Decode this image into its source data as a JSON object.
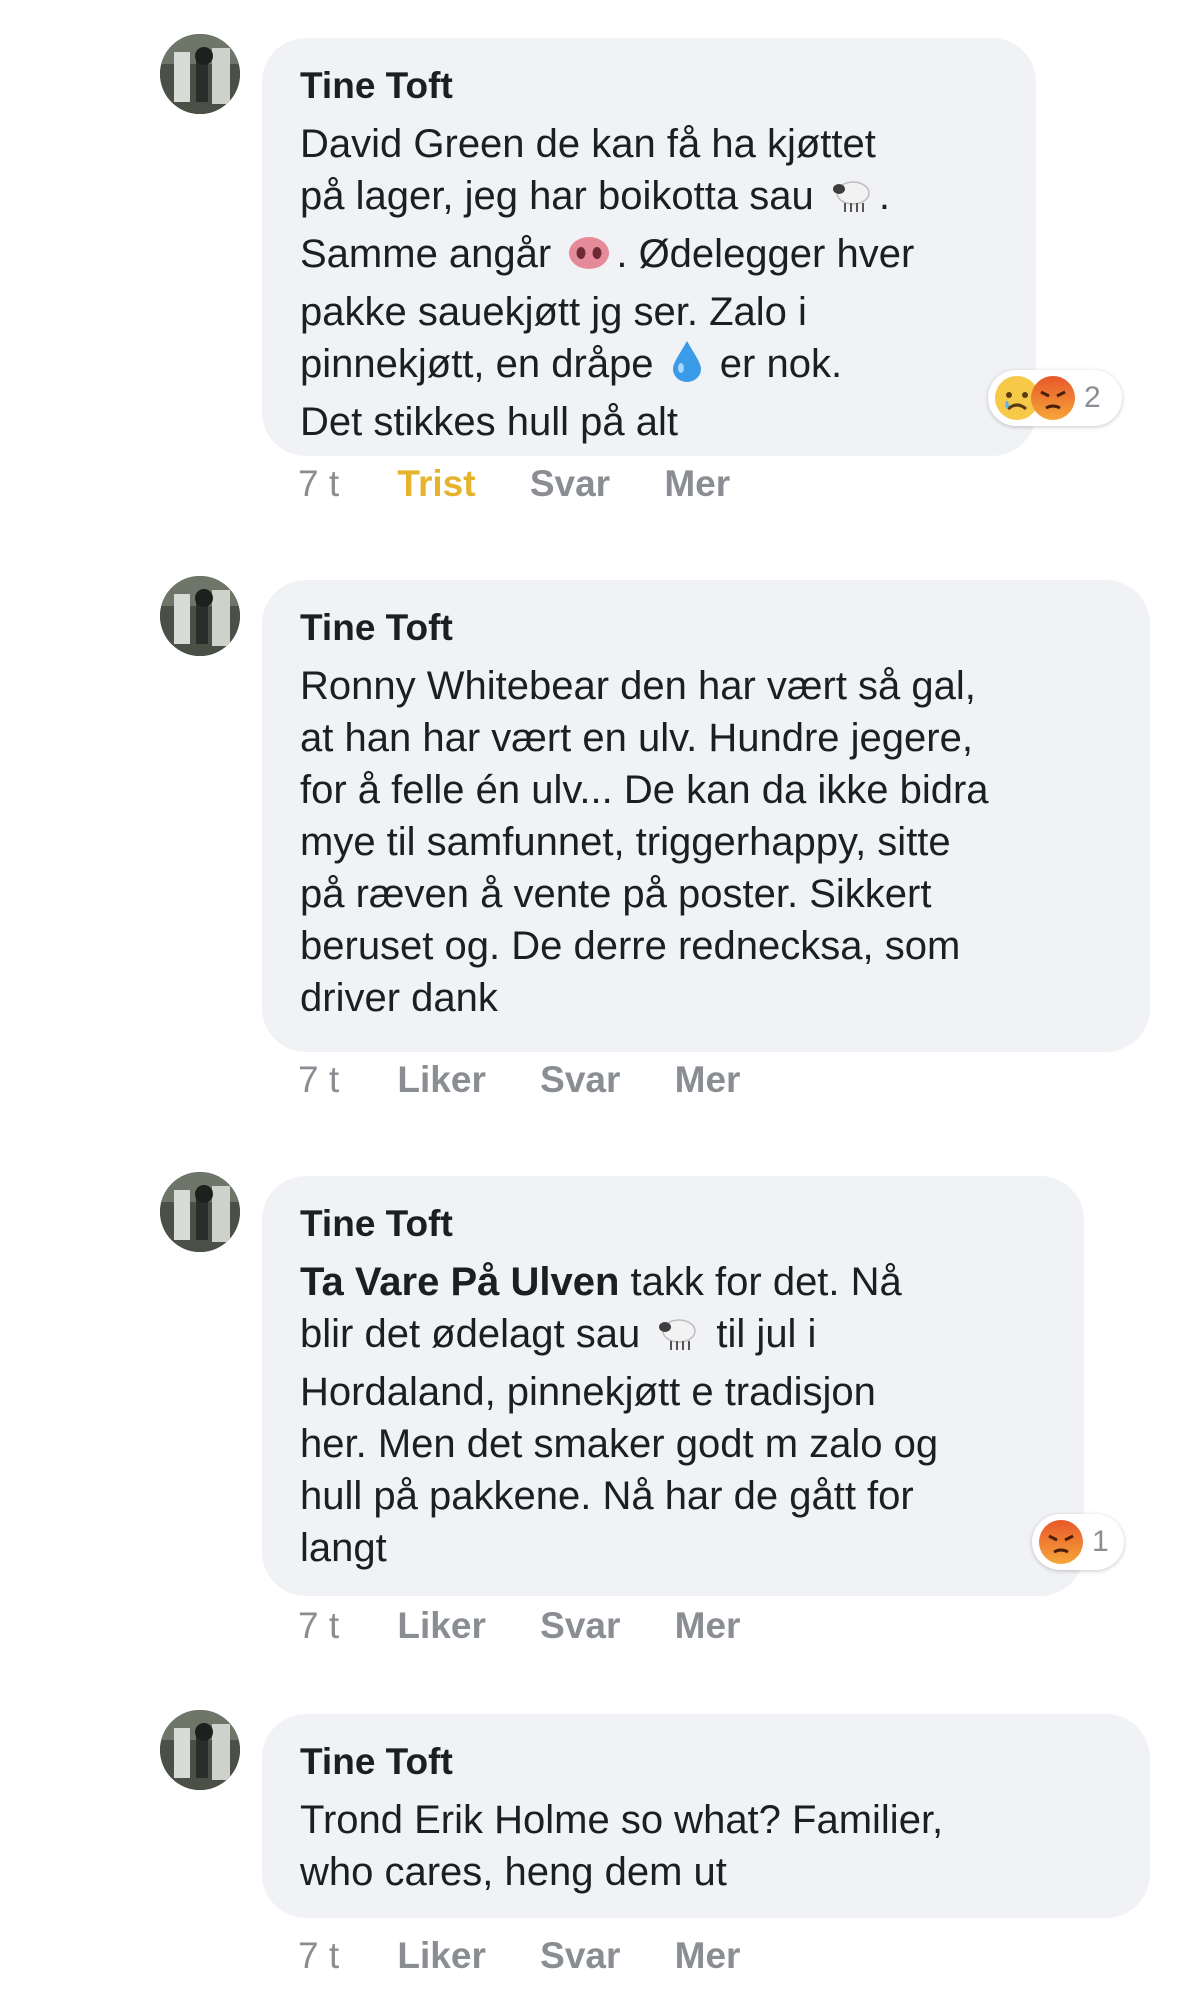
{
  "comments": [
    {
      "author": "Tine Toft",
      "lines": [
        [
          "David Green de kan få ha kjøttet"
        ],
        [
          "på lager, jeg har boikotta sau ",
          "sheep-emoji",
          "."
        ],
        [
          "Samme angår ",
          "pig-nose-emoji",
          ". Ødelegger hver"
        ],
        [
          "pakke sauekjøtt jg ser. Zalo i"
        ],
        [
          "pinnekjøtt, en dråpe ",
          "droplet-emoji",
          " er nok."
        ],
        [
          "Det stikkes hull på alt"
        ]
      ],
      "time": "7 t",
      "reaction_label": "Trist",
      "reply_label": "Svar",
      "more_label": "Mer",
      "reactions": [
        "sad",
        "angry"
      ],
      "reaction_count": "2"
    },
    {
      "author": "Tine Toft",
      "lines": [
        [
          "Ronny Whitebear den har vært så gal,"
        ],
        [
          "at han har vært en ulv. Hundre jegere,"
        ],
        [
          "for å felle én ulv... De kan da ikke bidra"
        ],
        [
          "mye til samfunnet, triggerhappy, sitte"
        ],
        [
          "på ræven å vente på poster. Sikkert"
        ],
        [
          "beruset og. De derre rednecksa, som"
        ],
        [
          "driver dank"
        ]
      ],
      "time": "7 t",
      "reaction_label": "Liker",
      "reply_label": "Svar",
      "more_label": "Mer"
    },
    {
      "author": "Tine Toft",
      "mention": "Ta Vare På Ulven",
      "lines": [
        [
          " takk for det. Nå"
        ],
        [
          "blir det ødelagt sau ",
          "sheep-emoji",
          " til jul i"
        ],
        [
          "Hordaland, pinnekjøtt e tradisjon"
        ],
        [
          "her. Men det smaker godt m zalo og"
        ],
        [
          "hull på pakkene. Nå har de gått for"
        ],
        [
          "langt"
        ]
      ],
      "time": "7 t",
      "reaction_label": "Liker",
      "reply_label": "Svar",
      "more_label": "Mer",
      "reactions": [
        "angry"
      ],
      "reaction_count": "1"
    },
    {
      "author": "Tine Toft",
      "lines": [
        [
          "Trond Erik Holme so what? Familier,"
        ],
        [
          "who cares, heng dem ut"
        ]
      ],
      "time": "7 t",
      "reaction_label": "Liker",
      "reply_label": "Svar",
      "more_label": "Mer"
    }
  ],
  "colors": {
    "bubble": "#f0f2f5",
    "text": "#1c1e21",
    "meta": "#8a8d91",
    "trist": "#e6b32c",
    "angry": "#e8572a",
    "sad": "#f7c948"
  }
}
